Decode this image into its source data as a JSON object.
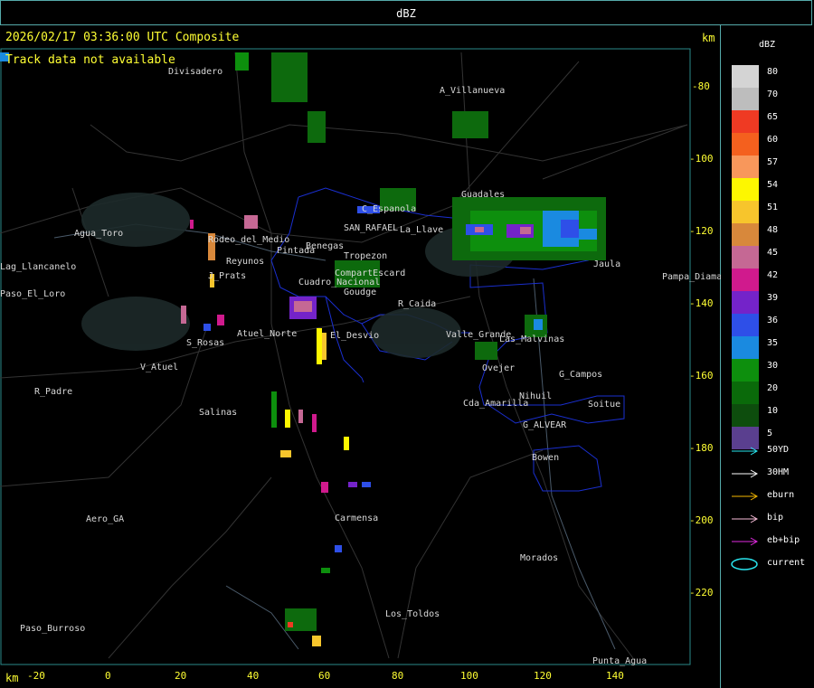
{
  "title": "dBZ",
  "header": {
    "timestamp": "2026/02/17 03:36:00 UTC Composite",
    "track_status": "Track data not available",
    "unit_top": "km",
    "unit_bottom": "km"
  },
  "axes": {
    "x_ticks": [
      "-20",
      "0",
      "20",
      "40",
      "60",
      "80",
      "100",
      "120",
      "140"
    ],
    "y_ticks": [
      "-80",
      "-100",
      "-120",
      "-140",
      "-160",
      "-180",
      "-200",
      "-220"
    ]
  },
  "places": [
    {
      "name": "Divisadero"
    },
    {
      "name": "A_Villanueva"
    },
    {
      "name": "Guadales"
    },
    {
      "name": "Agua_Toro"
    },
    {
      "name": "Rodeo_del_Medio"
    },
    {
      "name": "Reyunos"
    },
    {
      "name": "Pintada"
    },
    {
      "name": "Benegas"
    },
    {
      "name": "SAN_RAFAEL"
    },
    {
      "name": "C_Espanola"
    },
    {
      "name": "La_Llave"
    },
    {
      "name": "Cuadro_Nacional"
    },
    {
      "name": "Goudge"
    },
    {
      "name": "R_Caida"
    },
    {
      "name": "S_Rosas"
    },
    {
      "name": "Atuel_Norte"
    },
    {
      "name": "El_Desvio"
    },
    {
      "name": "Valle_Grande"
    },
    {
      "name": "Las_Malvinas"
    },
    {
      "name": "V_Atuel"
    },
    {
      "name": "R_Padre"
    },
    {
      "name": "Salinas"
    },
    {
      "name": "Cda_Amarilla"
    },
    {
      "name": "Nihuil"
    },
    {
      "name": "Soitue"
    },
    {
      "name": "G_ALVEAR"
    },
    {
      "name": "Bowen"
    },
    {
      "name": "Aero_GA"
    },
    {
      "name": "Carmensa"
    },
    {
      "name": "Morados"
    },
    {
      "name": "Los_Toldos"
    },
    {
      "name": "Paso_Burroso"
    },
    {
      "name": "Punta_Agua"
    },
    {
      "name": "Lag_Llancanelo"
    },
    {
      "name": "Paso_El_Loro"
    },
    {
      "name": "Jaula"
    },
    {
      "name": "Pampa_Diamante"
    },
    {
      "name": "G_Campos"
    },
    {
      "name": "Ovejer"
    },
    {
      "name": "CompartEscard"
    },
    {
      "name": "J_Prats"
    },
    {
      "name": "Tropezon"
    }
  ],
  "legend": {
    "title": "dBZ",
    "levels": [
      {
        "label": "80",
        "color": "#d4d4d4"
      },
      {
        "label": "70",
        "color": "#bdbdbd"
      },
      {
        "label": "65",
        "color": "#ef3a23"
      },
      {
        "label": "60",
        "color": "#f4601e"
      },
      {
        "label": "57",
        "color": "#f8975b"
      },
      {
        "label": "54",
        "color": "#fdf700"
      },
      {
        "label": "51",
        "color": "#f7c52c"
      },
      {
        "label": "48",
        "color": "#d8883b"
      },
      {
        "label": "45",
        "color": "#c56894"
      },
      {
        "label": "42",
        "color": "#d01a8d"
      },
      {
        "label": "39",
        "color": "#7423c9"
      },
      {
        "label": "36",
        "color": "#2e4fe8"
      },
      {
        "label": "35",
        "color": "#1a8ae0"
      },
      {
        "label": "30",
        "color": "#0d8f0d"
      },
      {
        "label": "20",
        "color": "#0a6a0a"
      },
      {
        "label": "10",
        "color": "#0d4d0d"
      },
      {
        "label": "5",
        "color": "#5a3f8f"
      }
    ],
    "tracks": [
      {
        "label": "50YD",
        "color": "#29e6f0"
      },
      {
        "label": "30HM",
        "color": "#ffffff"
      },
      {
        "label": "eburn",
        "color": "#f5b700"
      },
      {
        "label": "bip",
        "color": "#f7bcd8"
      },
      {
        "label": "eb+bip",
        "color": "#e02ae0"
      },
      {
        "label": "current",
        "color": "#29e6f0"
      }
    ]
  }
}
